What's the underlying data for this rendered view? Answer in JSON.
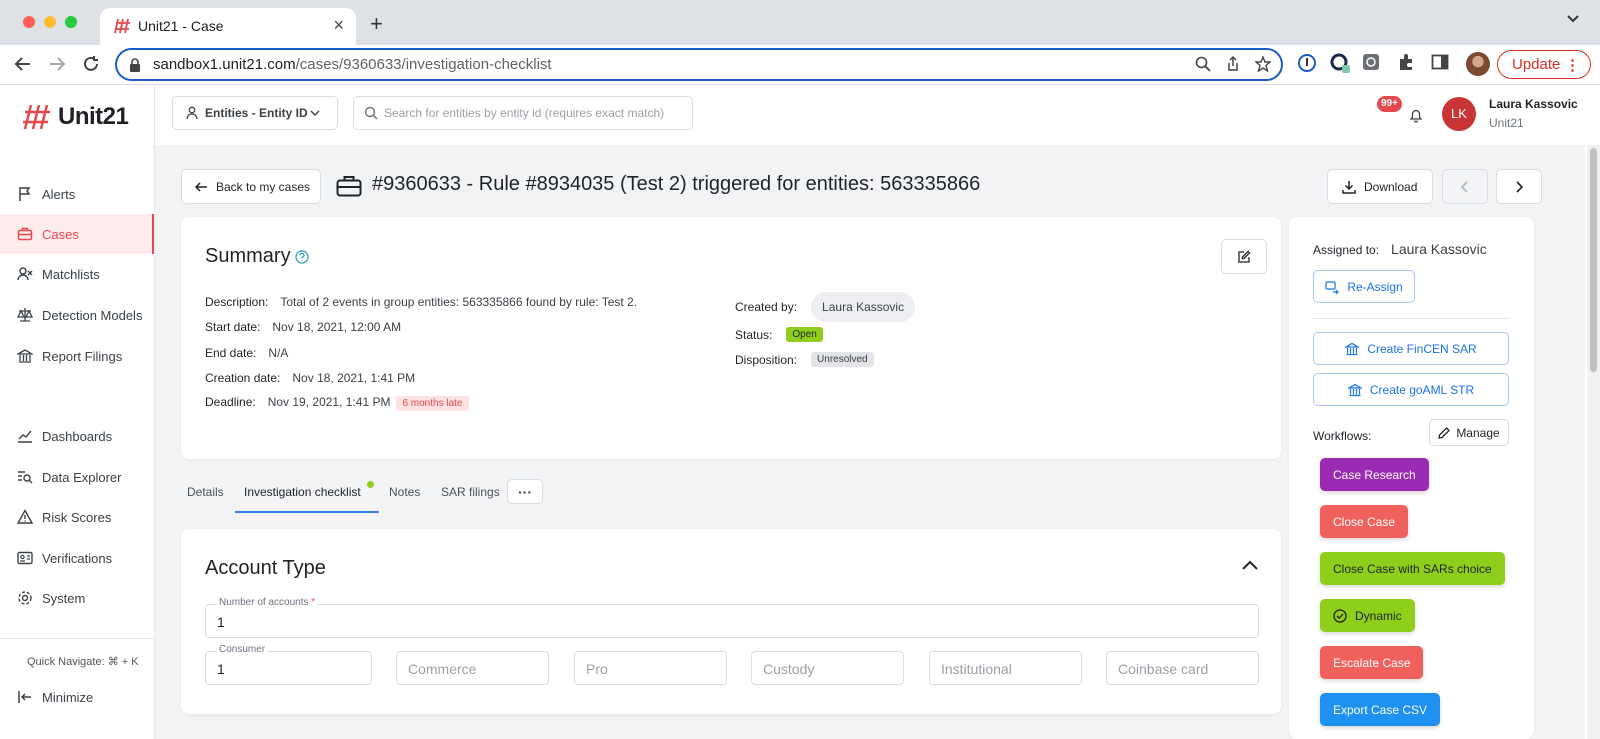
{
  "browser": {
    "tab_title": "Unit21 - Case",
    "url_domain": "sandbox1.unit21.com",
    "url_path": "/cases/9360633/investigation-checklist",
    "update_label": "Update"
  },
  "sidebar": {
    "logo_text": "Unit21",
    "items": [
      {
        "label": "Alerts",
        "icon": "flag-icon"
      },
      {
        "label": "Cases",
        "icon": "briefcase-icon",
        "active": true
      },
      {
        "label": "Matchlists",
        "icon": "user-x-icon"
      },
      {
        "label": "Detection Models",
        "icon": "scale-icon"
      },
      {
        "label": "Report Filings",
        "icon": "bank-icon"
      },
      {
        "label": "Dashboards",
        "icon": "chart-line-icon"
      },
      {
        "label": "Data Explorer",
        "icon": "search-list-icon"
      },
      {
        "label": "Risk Scores",
        "icon": "warning-icon"
      },
      {
        "label": "Verifications",
        "icon": "id-card-icon"
      },
      {
        "label": "System",
        "icon": "gear-icon"
      }
    ],
    "quick_navigate": "Quick Navigate: ⌘ + K",
    "minimize": "Minimize"
  },
  "topbar": {
    "entity_dropdown": "Entities - Entity ID",
    "search_placeholder": "Search for entities by entity id (requires exact match)",
    "notifications_badge": "99+",
    "avatar_initials": "LK",
    "user_name": "Laura Kassovic",
    "user_org": "Unit21"
  },
  "header": {
    "back_label": "Back to my cases",
    "case_title": "#9360633 - Rule #8934035 (Test 2) triggered for entities: 563335866",
    "download_label": "Download"
  },
  "summary": {
    "title": "Summary",
    "description_label": "Description:",
    "description_value": "Total of 2 events in group entities: 563335866 found by rule: Test 2.",
    "start_label": "Start date:",
    "start_value": "Nov 18, 2021, 12:00 AM",
    "end_label": "End date:",
    "end_value": "N/A",
    "creation_label": "Creation date:",
    "creation_value": "Nov 18, 2021, 1:41 PM",
    "deadline_label": "Deadline:",
    "deadline_value": "Nov 19, 2021, 1:41 PM",
    "late_badge": "6 months late",
    "created_by_label": "Created by:",
    "created_by_value": "Laura Kassovic",
    "status_label": "Status:",
    "status_value": "Open",
    "disposition_label": "Disposition:",
    "disposition_value": "Unresolved"
  },
  "tabs": [
    "Details",
    "Investigation checklist",
    "Notes",
    "SAR filings"
  ],
  "tabs_more": "···",
  "account_type": {
    "title": "Account Type",
    "num_accounts_label": "Number of accounts",
    "num_accounts_value": "1",
    "consumer_label": "Consumer",
    "consumer_value": "1",
    "placeholders": [
      "Commerce",
      "Pro",
      "Custody",
      "Institutional",
      "Coinbase card"
    ]
  },
  "side_panel": {
    "assigned_label": "Assigned to:",
    "assigned_value": "Laura Kassovic",
    "reassign_label": "Re-Assign",
    "fincen_label": "Create FinCEN SAR",
    "goaml_label": "Create goAML STR",
    "workflows_label": "Workflows:",
    "manage_label": "Manage",
    "workflows": [
      {
        "label": "Case Research",
        "color": "#9b2bb3",
        "text": "#ffffff"
      },
      {
        "label": "Close Case",
        "color": "#f0605d",
        "text": "#ffffff"
      },
      {
        "label": "Close Case with SARs choice",
        "color": "#8fce1b",
        "text": "#1f2328"
      },
      {
        "label": "Dynamic",
        "color": "#8fce1b",
        "text": "#1f2328"
      },
      {
        "label": "Escalate Case",
        "color": "#f0605d",
        "text": "#ffffff"
      },
      {
        "label": "Export Case CSV",
        "color": "#1e90f0",
        "text": "#ffffff"
      }
    ]
  },
  "colors": {
    "accent_red": "#e5484d",
    "link_blue": "#1a73e8",
    "tab_blue": "#2f80ed"
  }
}
